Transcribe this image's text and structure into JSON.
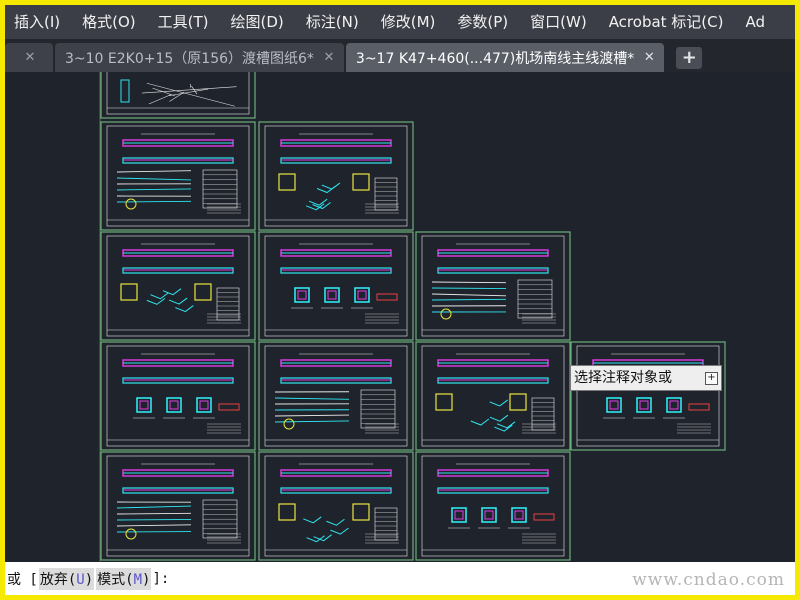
{
  "menu": {
    "items": [
      {
        "label": "插入(I)"
      },
      {
        "label": "格式(O)"
      },
      {
        "label": "工具(T)"
      },
      {
        "label": "绘图(D)"
      },
      {
        "label": "标注(N)"
      },
      {
        "label": "修改(M)"
      },
      {
        "label": "参数(P)"
      },
      {
        "label": "窗口(W)"
      },
      {
        "label": "Acrobat 标记(C)"
      },
      {
        "label": "Ad"
      }
    ]
  },
  "tabs": {
    "items": [
      {
        "label": "3~10 E2K0+15（原156）渡槽图纸6*",
        "active": false
      },
      {
        "label": "3~17 K47+460(...477)机场南线主线渡槽*",
        "active": true
      }
    ],
    "close_glyph": "✕",
    "add_glyph": "+"
  },
  "colors": {
    "sheet_border": "#6fae7a",
    "sheet_bg": "#1f232b",
    "cyan": "#2fe6f0",
    "magenta": "#e23ce8",
    "white": "#e8e8e8",
    "yellow": "#e8e640",
    "red": "#e84040"
  },
  "tooltip": {
    "text": "选择注释对象或",
    "expand_glyph": "+"
  },
  "command": {
    "prefix": "或 [",
    "options": [
      {
        "label": "放弃(",
        "key": "U",
        "suffix": ")"
      },
      {
        "label": "模式(",
        "key": "M",
        "suffix": ")"
      }
    ],
    "suffix": "]:"
  },
  "watermark": "www.cndao.com"
}
